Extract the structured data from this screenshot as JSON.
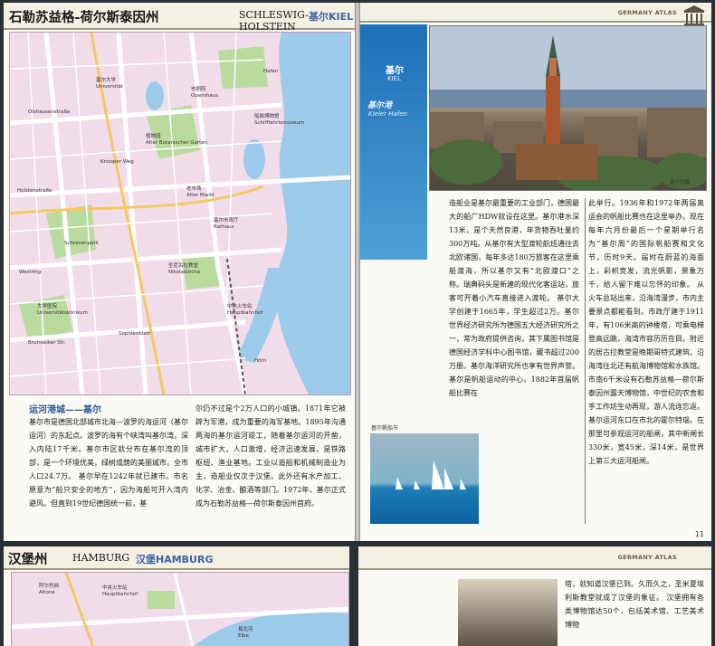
{
  "left_page": {
    "title": "石勒苏益格-荷尔斯泰因州",
    "title_en": "SCHLESWIG-HOLSTEIN",
    "city_tag": "基尔KIEL",
    "map_labels": [
      "基尔市政厅",
      "Rathaus",
      "中央火车站",
      "Hauptbahnhof",
      "老市场",
      "Alter Markt",
      "圣尼古拉教堂",
      "Nikolaikirche",
      "植物园",
      "Alter Botanischer Garten",
      "基尔大学",
      "Universität",
      "Holstenstraße",
      "Kleiner Kiel",
      "Schrevenpark",
      "Hafen",
      "船舶博物馆",
      "Schifffahrtsmuseum",
      "动物园",
      "Zoologisches Museum",
      "市剧院",
      "Opernhaus",
      "Olshausenstraße",
      "Westring",
      "Ringstraße",
      "Knooper Weg",
      "Brunswiker Str.",
      "Feldstraße",
      "Düppelstraße",
      "Sophienblatt",
      "Karlstal",
      "Gaardener Brücke",
      "Hörn",
      "Schützenpark",
      "大学医院",
      "Universitätsklinikum"
    ],
    "section_title": "运河港城——基尔",
    "col1": "基尔市是德国北部城市北海—波罗的海运河（基尔运河）的东起点。波罗的海有个峡湾叫基尔湾，深入内陆17千米。基尔市区就分布在基尔湾的顶部，是一个环境优美，绿树成荫的美丽城市。全市人口24.7万。 基尔早在1242年就已建市。市名原意为“船只安全的地方”，因为海船可开入湾内避风。但直到19世纪德国统一前，基",
    "col2": "尔仍不过是个2万人口的小城镇。1871年它被辟为军港，成为重要的海军基地。1895年沟通两海的基尔运河竣工，随着基尔运河的开凿，城市扩大，人口激增，经济迅速发展，是铁路枢纽、渔业基地。工业以造船和机械制造业为主，造船业仅次于汉堡。此外还有水产加工、化学、冶金、酿酒等部门。1972年，基尔正式成为石勒苏益格—荷尔斯泰因州首府。",
    "page_number": ""
  },
  "right_page": {
    "header_tag": "GERMANY ATLAS",
    "kiel_cn": "基尔",
    "kiel_en": "KIEL",
    "port_cn": "基尔港",
    "port_en": "Kieler Hafen",
    "photo_caption": "基尔鸟瞰",
    "sail_caption": "基尔帆船节",
    "col1": "造船业是基尔最重要的工业部门，德国最大的船厂HDW就设在这里。基尔港水深13米，是个天然良港，年货物吞吐量约300万吨。从基尔有大型渡轮航班通往去北欧诸国，每年多达180万旅客在这里乘船渡海，所以基尔又有“北欧渡口”之称。瑞典码头是新建的现代化客运站，旅客可开着小汽车直接进入渡轮。 基尔大学创建于1665年，学生超过2万。基尔世界经济研究所为德国五大经济研究所之一，常为政府提供咨询，其下属图书馆是德国经济学科中心图书馆，藏书超过200万册。基尔海洋研究所也享有世界声誉。 基尔是帆船运动的中心。1882年首届帆船比赛在",
    "col2": "此举行。1936年和1972年两届奥运会的帆船比赛也在这里举办。现在每年六月份最后一个星期举行名为“基尔周”的国际帆船赛和文化节，历时9天。届时在蔚蓝的海面上，彩帜竞发，流光帆影，景象万千，给人留下难以忘怀的印象。 从火车总站出来，沿海湾漫步，市内主要景点都能看到。市政厅建于1911年，有106米高的钟楼塔，可乘电梯登高远眺，海湾市容历历在目。附近的居古拉教堂是晚期哥特式建筑。沿海湾往北还有航海博物馆和水族馆。市南6千米设有石勒苏益格—荷尔斯泰因州露天博物馆，中世纪的农舍和手工作坊生动再现，游人流连忘返。 基尔运河东口在市北的霍尔特瑙，在那里可参观运河的船闸，其中新闸长330米，宽45米，深14米，是世界上第三大运河船闸。",
    "page_number": "11"
  },
  "bottom_left": {
    "title": "汉堡州",
    "title_en": "HAMBURG",
    "city_tag": "汉堡HAMBURG",
    "map_labels": [
      "阿尔托纳",
      "Altona",
      "霍恩哈芬",
      "Hammerbrook",
      "易北河",
      "Elbe",
      "中央火车站",
      "Hauptbahnhof",
      "Lübecker",
      "Bergedorf"
    ]
  },
  "bottom_right": {
    "header_tag": "GERMANY ATLAS",
    "text": "塔，就知道汉堡已到。久而久之，圣米夏埃利斯教堂就成了汉堡的象征。 汉堡拥有各类博物馆达50个，包括美术馆、工艺美术博物"
  },
  "colors": {
    "map_bg": "#f1dcea",
    "road": "#ffffff",
    "water": "#9ccbe9",
    "park": "#b9dc9e",
    "header_bg": "#f4f1e4",
    "accent_blue": "#2d5aa0"
  }
}
